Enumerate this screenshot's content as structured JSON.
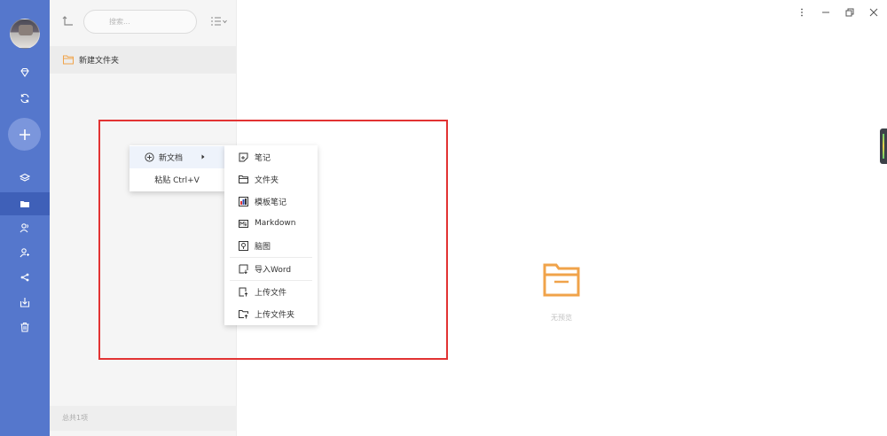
{
  "sidebar": {
    "avatar_label": "user avatar"
  },
  "panel": {
    "search_placeholder": "搜索...",
    "files": [
      {
        "name": "新建文件夹"
      }
    ],
    "footer": "总共1项"
  },
  "context_menu": {
    "new_doc": "新文档",
    "paste": "粘贴 Ctrl+V"
  },
  "submenu": {
    "items": [
      {
        "label": "笔记",
        "icon": "note-icon"
      },
      {
        "label": "文件夹",
        "icon": "folder-icon"
      },
      {
        "label": "模板笔记",
        "icon": "template-icon"
      },
      {
        "label": "Markdown",
        "icon": "markdown-icon"
      },
      {
        "label": "脑图",
        "icon": "mindmap-icon"
      },
      {
        "label": "导入Word",
        "icon": "import-word-icon"
      },
      {
        "label": "上传文件",
        "icon": "upload-file-icon"
      },
      {
        "label": "上传文件夹",
        "icon": "upload-folder-icon"
      }
    ]
  },
  "preview": {
    "empty_text": "无预览"
  },
  "colors": {
    "sidebar": "#5577cc",
    "accent_orange": "#f0a34a",
    "highlight": "#e23333"
  }
}
